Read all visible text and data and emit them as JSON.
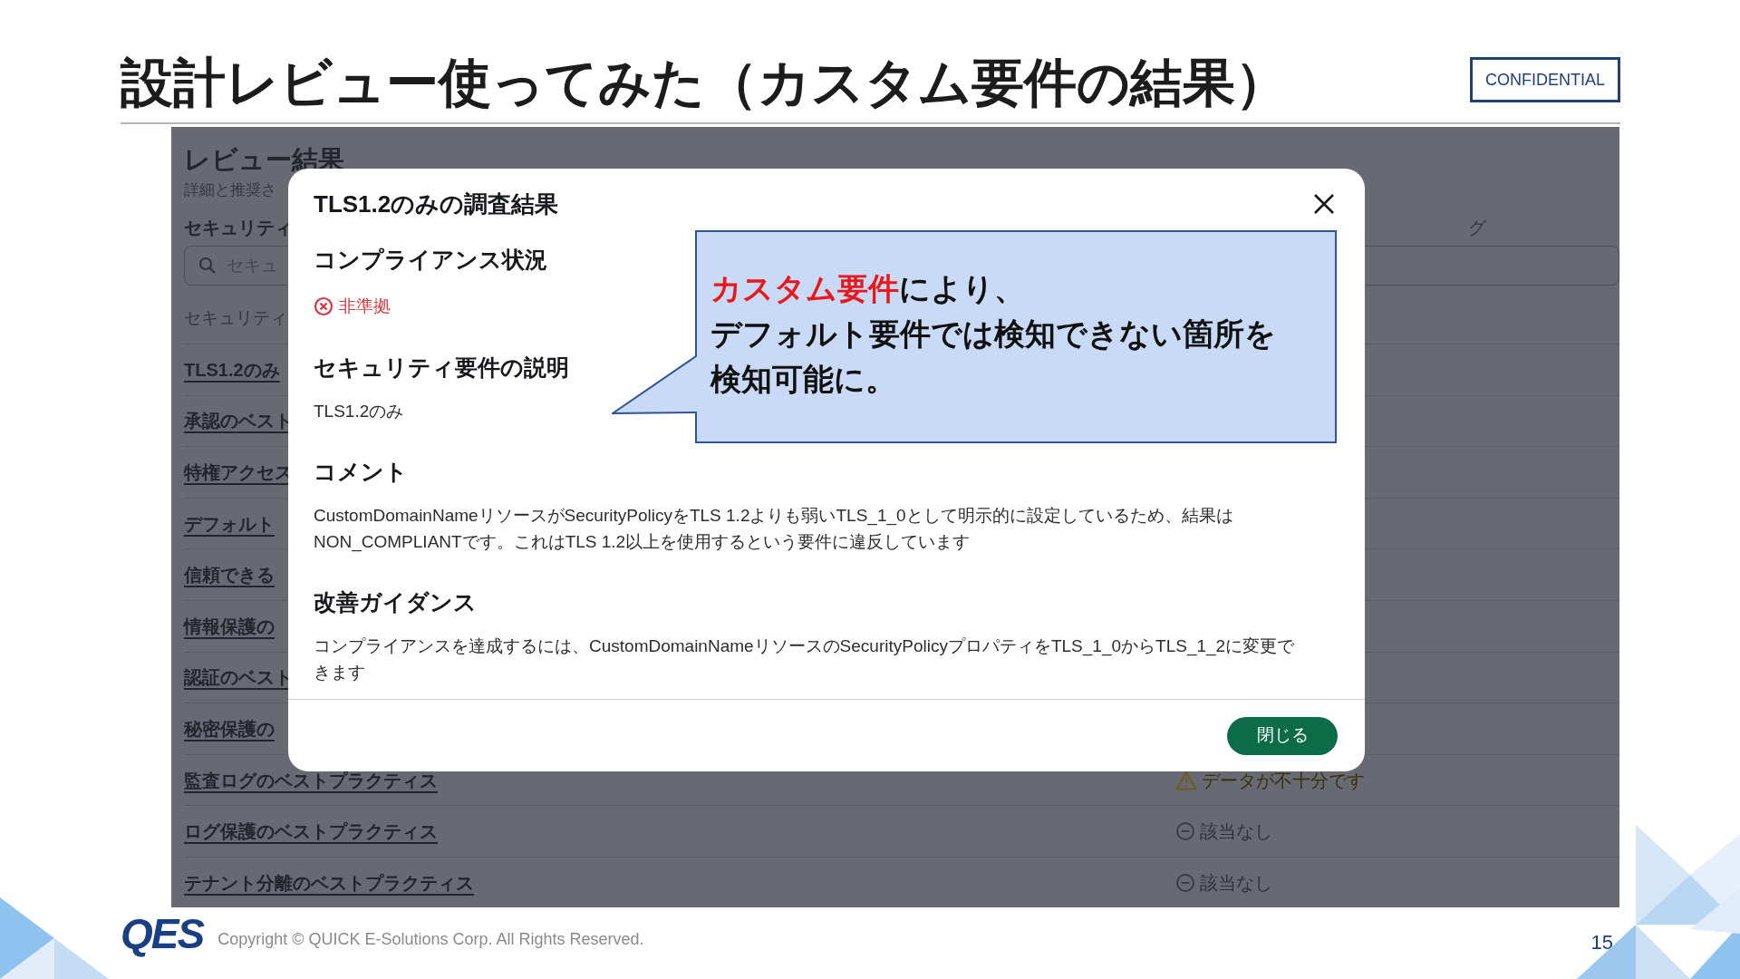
{
  "slide": {
    "title": "設計レビュー使ってみた（カスタム要件の結果）",
    "badge": "CONFIDENTIAL",
    "logo": "QES",
    "copyright": "Copyright © QUICK E-Solutions Corp. All Rights Reserved.",
    "page_number": "15"
  },
  "app": {
    "heading": "レビュー結果",
    "subheading": "詳細と推奨さ",
    "filter_label": "セキュリティ",
    "column_2_header": "グ",
    "search": {
      "placeholder": "セキュ"
    },
    "table": {
      "column_1": "セキュリティ",
      "rows": [
        {
          "name": "TLS1.2のみ"
        },
        {
          "name": "承認のベスト"
        },
        {
          "name": "特権アクセス"
        },
        {
          "name": "デフォルト"
        },
        {
          "name": "信頼できる"
        },
        {
          "name": "情報保護の"
        },
        {
          "name": "認証のベスト"
        },
        {
          "name": "秘密保護の"
        },
        {
          "name": "監査ログのベストプラクティス",
          "status": "データが不十分です",
          "kind": "warning"
        },
        {
          "name": "ログ保護のベストプラクティス",
          "status": "該当なし",
          "kind": "not_applicable"
        },
        {
          "name": "テナント分離のベストプラクティス",
          "status": "該当なし",
          "kind": "not_applicable"
        }
      ]
    }
  },
  "dialog": {
    "title": "TLS1.2のみの調査結果",
    "compliance": {
      "heading": "コンプライアンス状況",
      "status": "非準拠",
      "kind": "non_compliant"
    },
    "sections": [
      {
        "heading": "セキュリティ要件の説明",
        "body": "TLS1.2のみ"
      },
      {
        "heading": "コメント",
        "body": "CustomDomainNameリソースがSecurityPolicyをTLS 1.2よりも弱いTLS_1_0として明示的に設定しているため、結果はNON_COMPLIANTです。これはTLS 1.2以上を使用するという要件に違反しています"
      },
      {
        "heading": "改善ガイダンス",
        "body": "コンプライアンスを達成するには、CustomDomainNameリソースのSecurityPolicyプロパティをTLS_1_0からTLS_1_2に変更できます"
      }
    ],
    "button": "閉じる"
  },
  "callout": {
    "lines": [
      [
        {
          "text": "カスタム要件",
          "highlight": true
        },
        {
          "text": "により、",
          "highlight": false
        }
      ],
      [
        {
          "text": "デフォルト要件では検知できない箇所を",
          "highlight": false
        }
      ],
      [
        {
          "text": "検知可能に。",
          "highlight": false
        }
      ]
    ]
  }
}
